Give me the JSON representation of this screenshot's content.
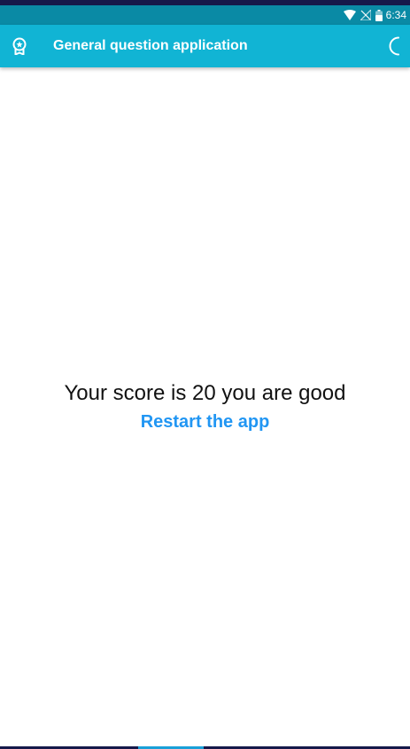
{
  "status_bar": {
    "time": "6:34",
    "icons": [
      "wifi-icon",
      "signal-off-icon",
      "battery-icon"
    ],
    "background": "#0a8aa5"
  },
  "app_bar": {
    "title": "General question application",
    "leading_icon": "award-badge-icon",
    "trailing_icon": "moon-icon",
    "background": "#11b4d4"
  },
  "main": {
    "score_text": "Your score is 20 you are good",
    "restart_label": "Restart the app",
    "link_color": "#2196f3"
  }
}
